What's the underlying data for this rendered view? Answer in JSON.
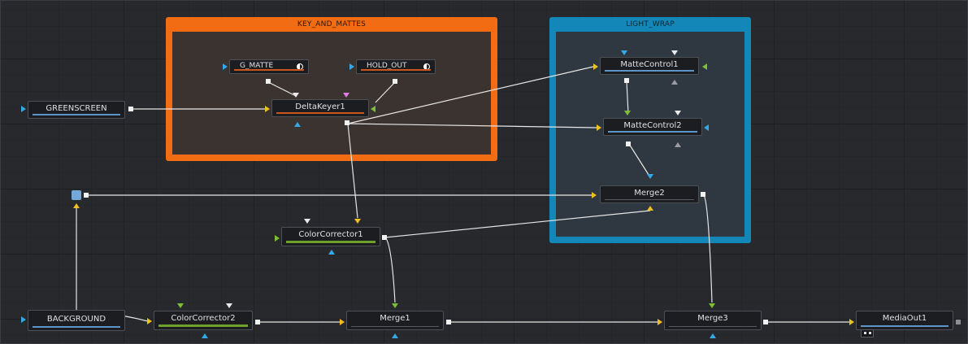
{
  "colors": {
    "canvas": "#28292d",
    "grid": "#1f2024",
    "group_key_and_mattes": "#f26c13",
    "group_light_wrap": "#1387b8",
    "wire": "#e6e6e6",
    "port_yellow": "#f0c020",
    "port_blue": "#35a8e8",
    "port_green": "#7ec034",
    "port_pink": "#e37ce0"
  },
  "groups": {
    "key_and_mattes": {
      "title": "KEY_AND_MATTES"
    },
    "light_wrap": {
      "title": "LIGHT_WRAP"
    }
  },
  "nodes": {
    "greenscreen": {
      "label": "GREENSCREEN",
      "type": "loader"
    },
    "background": {
      "label": "BACKGROUND",
      "type": "loader"
    },
    "g_matte": {
      "label": "G_MATTE",
      "type": "mask",
      "icon": "mask-icon"
    },
    "hold_out": {
      "label": "HOLD_OUT",
      "type": "mask",
      "icon": "mask-icon"
    },
    "deltakeyer1": {
      "label": "DeltaKeyer1",
      "type": "keyer"
    },
    "mattecontrol1": {
      "label": "MatteControl1",
      "type": "matte"
    },
    "mattecontrol2": {
      "label": "MatteControl2",
      "type": "matte"
    },
    "merge2": {
      "label": "Merge2",
      "type": "merge"
    },
    "colorcorrector1": {
      "label": "ColorCorrector1",
      "type": "color"
    },
    "colorcorrector2": {
      "label": "ColorCorrector2",
      "type": "color"
    },
    "merge1": {
      "label": "Merge1",
      "type": "merge"
    },
    "merge3": {
      "label": "Merge3",
      "type": "merge"
    },
    "mediaout1": {
      "label": "MediaOut1",
      "type": "output"
    }
  },
  "connections": [
    [
      "GREENSCREEN",
      "DeltaKeyer1"
    ],
    [
      "G_MATTE",
      "DeltaKeyer1"
    ],
    [
      "HOLD_OUT",
      "DeltaKeyer1"
    ],
    [
      "DeltaKeyer1",
      "MatteControl1"
    ],
    [
      "DeltaKeyer1",
      "MatteControl2"
    ],
    [
      "DeltaKeyer1",
      "ColorCorrector1"
    ],
    [
      "MatteControl1",
      "MatteControl2"
    ],
    [
      "MatteControl2",
      "Merge2"
    ],
    [
      "BACKGROUND",
      "Pipe Router"
    ],
    [
      "Pipe Router",
      "Merge2"
    ],
    [
      "BACKGROUND",
      "ColorCorrector2"
    ],
    [
      "ColorCorrector2",
      "Merge1"
    ],
    [
      "ColorCorrector1",
      "Merge1"
    ],
    [
      "ColorCorrector1",
      "Merge2"
    ],
    [
      "Merge1",
      "Merge3"
    ],
    [
      "Merge2",
      "Merge3"
    ],
    [
      "Merge3",
      "MediaOut1"
    ]
  ]
}
